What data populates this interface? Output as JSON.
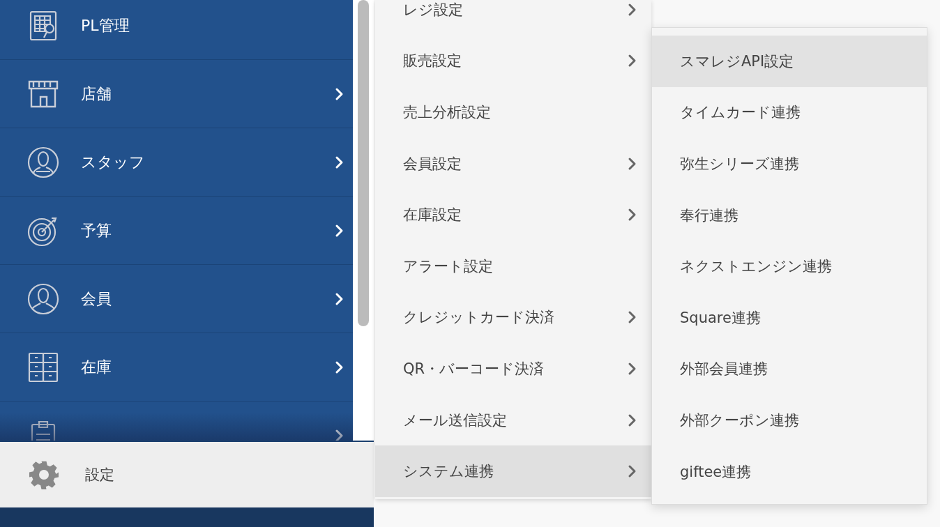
{
  "sidebar": {
    "items": [
      {
        "label": "PL管理",
        "has_submenu": false
      },
      {
        "label": "店舗",
        "has_submenu": true
      },
      {
        "label": "スタッフ",
        "has_submenu": true
      },
      {
        "label": "予算",
        "has_submenu": true
      },
      {
        "label": "会員",
        "has_submenu": true
      },
      {
        "label": "在庫",
        "has_submenu": true
      },
      {
        "has_submenu": true
      }
    ],
    "settings": {
      "label": "設定"
    }
  },
  "menu": {
    "items": [
      {
        "label": "レジ設定",
        "has_submenu": true,
        "selected": false
      },
      {
        "label": "販売設定",
        "has_submenu": true,
        "selected": false
      },
      {
        "label": "売上分析設定",
        "has_submenu": false,
        "selected": false
      },
      {
        "label": "会員設定",
        "has_submenu": true,
        "selected": false
      },
      {
        "label": "在庫設定",
        "has_submenu": true,
        "selected": false
      },
      {
        "label": "アラート設定",
        "has_submenu": false,
        "selected": false
      },
      {
        "label": "クレジットカード決済",
        "has_submenu": true,
        "selected": false
      },
      {
        "label": "QR・バーコード決済",
        "has_submenu": true,
        "selected": false
      },
      {
        "label": "メール送信設定",
        "has_submenu": true,
        "selected": false
      },
      {
        "label": "システム連携",
        "has_submenu": true,
        "selected": true
      }
    ]
  },
  "submenu": {
    "items": [
      {
        "label": "スマレジAPI設定",
        "selected": true
      },
      {
        "label": "タイムカード連携",
        "selected": false
      },
      {
        "label": "弥生シリーズ連携",
        "selected": false
      },
      {
        "label": "奉行連携",
        "selected": false
      },
      {
        "label": "ネクストエンジン連携",
        "selected": false
      },
      {
        "label": "Square連携",
        "selected": false
      },
      {
        "label": "外部会員連携",
        "selected": false
      },
      {
        "label": "外部クーポン連携",
        "selected": false
      },
      {
        "label": "giftee連携",
        "selected": false
      }
    ]
  }
}
